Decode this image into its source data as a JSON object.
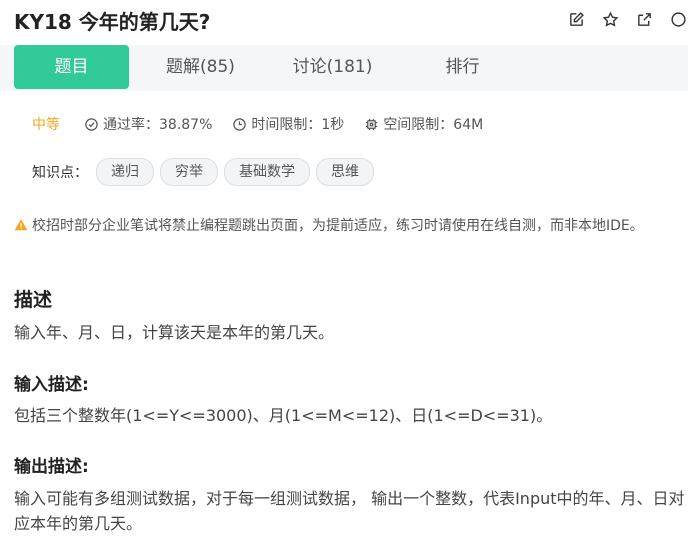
{
  "problem": {
    "title": "KY18  今年的第几天?"
  },
  "tabs": [
    {
      "label": "题目"
    },
    {
      "label": "题解(85)"
    },
    {
      "label": "讨论(181)"
    },
    {
      "label": "排行"
    }
  ],
  "meta": {
    "difficulty": "中等",
    "pass_rate": "通过率：38.87%",
    "time_limit": "时间限制：1秒",
    "memory_limit": "空间限制：64M"
  },
  "knowledge": {
    "label": "知识点：",
    "tags": [
      "递归",
      "穷举",
      "基础数学",
      "思维"
    ]
  },
  "notice": "校招时部分企业笔试将禁止编程题跳出页面，为提前适应，练习时请使用在线自测，而非本地IDE。",
  "sections": {
    "desc_title": "描述",
    "desc_text": "输入年、月、日，计算该天是本年的第几天。",
    "input_title": "输入描述:",
    "input_text": "包括三个整数年(1<=Y<=3000)、月(1<=M<=12)、日(1<=D<=31)。",
    "output_title": "输出描述:",
    "output_text": "输入可能有多组测试数据，对于每一组测试数据， 输出一个整数，代表Input中的年、月、日对应本年的第几天。"
  },
  "colors": {
    "accent": "#32ca99",
    "difficulty": "#f5a623",
    "warning": "#f5a623"
  }
}
